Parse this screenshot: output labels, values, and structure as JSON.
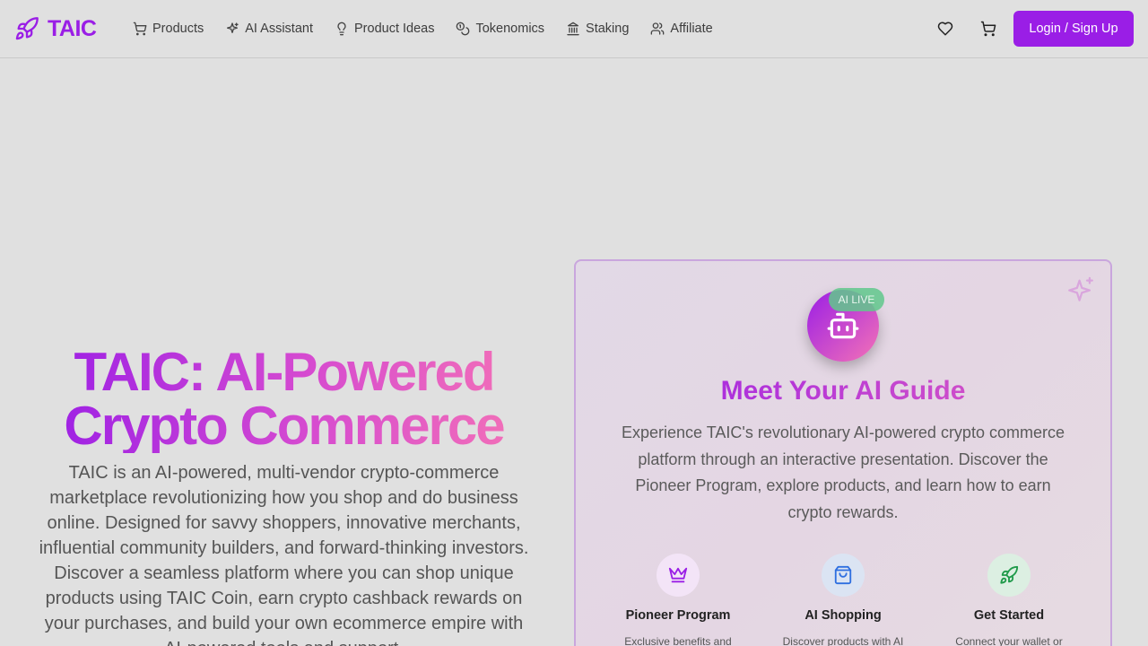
{
  "brand": {
    "name": "TAIC"
  },
  "nav": {
    "items": [
      {
        "label": "Products",
        "icon": "cart-icon"
      },
      {
        "label": "AI Assistant",
        "icon": "sparkles-icon"
      },
      {
        "label": "Product Ideas",
        "icon": "lightbulb-icon"
      },
      {
        "label": "Tokenomics",
        "icon": "coins-icon"
      },
      {
        "label": "Staking",
        "icon": "bank-icon"
      },
      {
        "label": "Affiliate",
        "icon": "users-icon"
      }
    ],
    "login_label": "Login / Sign Up"
  },
  "hero": {
    "title": "TAIC: AI-Powered Crypto Commerce",
    "description": "TAIC is an AI-powered, multi-vendor crypto-commerce marketplace revolutionizing how you shop and do business online. Designed for savvy shoppers, innovative merchants, influential community builders, and forward-thinking investors. Discover a seamless platform where you can shop unique products using TAIC Coin, earn crypto cashback rewards on your purchases, and build your own ecommerce empire with AI-powered tools and support."
  },
  "guide_card": {
    "badge": "AI LIVE",
    "title": "Meet Your AI Guide",
    "description": "Experience TAIC's revolutionary AI-powered crypto commerce platform through an interactive presentation. Discover the Pioneer Program, explore products, and learn how to earn crypto rewards.",
    "features": [
      {
        "title": "Pioneer Program",
        "desc": "Exclusive benefits and",
        "icon": "crown-icon",
        "bg": "#f3e4f7",
        "color": "#9a1ee6"
      },
      {
        "title": "AI Shopping",
        "desc": "Discover products with AI",
        "icon": "shopping-bag-icon",
        "bg": "#dbe4f3",
        "color": "#2f6fe0"
      },
      {
        "title": "Get Started",
        "desc": "Connect your wallet or",
        "icon": "rocket-icon",
        "bg": "#dcefe2",
        "color": "#1f9a4a"
      }
    ]
  },
  "colors": {
    "brand": "#9a1ee6",
    "accent_pink": "#f472b6"
  }
}
